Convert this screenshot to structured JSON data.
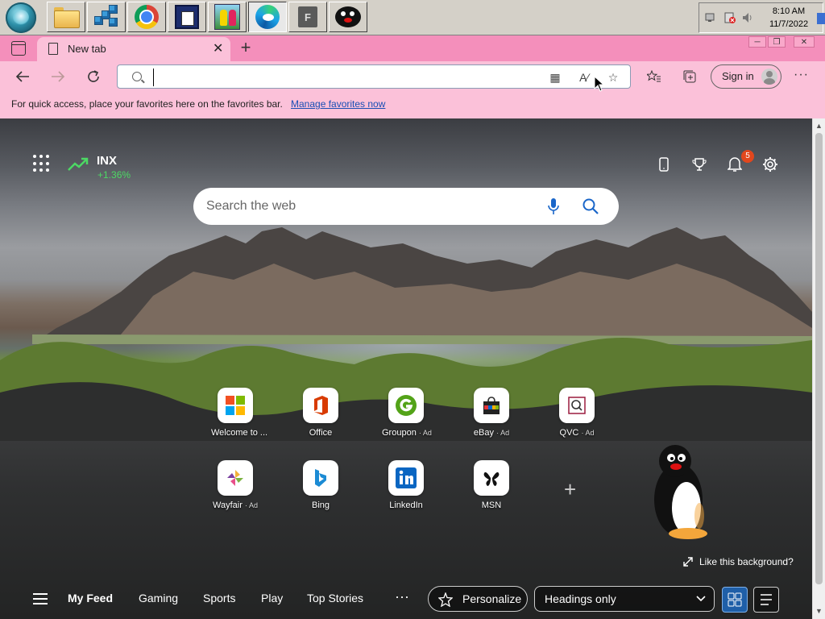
{
  "taskbar": {
    "items": [
      "start-orb",
      "file-explorer",
      "network-app",
      "chrome",
      "document-app",
      "kids-app",
      "edge",
      "f-app",
      "pingu-app"
    ],
    "f_app_label": "F",
    "clock": {
      "time": "8:10 AM",
      "date": "11/7/2022"
    }
  },
  "browser": {
    "tab": {
      "title": "New tab",
      "close": "✕"
    },
    "new_tab": "+",
    "address": {
      "value": "",
      "placeholder": ""
    },
    "signin": "Sign in",
    "more": "···",
    "favbar": {
      "text": "For quick access, place your favorites here on the favorites bar.",
      "link": "Manage favorites now"
    }
  },
  "ntp": {
    "stock": {
      "name": "INX",
      "change": "+1.36%"
    },
    "notifications": "5",
    "search": {
      "placeholder": "Search the web"
    },
    "tiles_row1": [
      {
        "label": "Welcome to ...",
        "ad": ""
      },
      {
        "label": "Office",
        "ad": ""
      },
      {
        "label": "Groupon",
        "ad": "· Ad"
      },
      {
        "label": "eBay",
        "ad": "· Ad"
      },
      {
        "label": "QVC",
        "ad": "· Ad"
      }
    ],
    "tiles_row2": [
      {
        "label": "Wayfair",
        "ad": "· Ad"
      },
      {
        "label": "Bing",
        "ad": ""
      },
      {
        "label": "LinkedIn",
        "ad": ""
      },
      {
        "label": "MSN",
        "ad": ""
      }
    ],
    "add_tile": "+",
    "like_background": "Like this background?",
    "feed": {
      "links": [
        "My Feed",
        "Gaming",
        "Sports",
        "Play",
        "Top Stories"
      ],
      "more": "···",
      "personalize": "Personalize",
      "headings": "Headings only"
    }
  },
  "colors": {
    "accent_pink": "#f48fbb",
    "toolbar_pink": "#fbc1d9",
    "link_blue": "#1a4fb5",
    "stock_green": "#4cd964",
    "badge_orange": "#e2471d"
  }
}
